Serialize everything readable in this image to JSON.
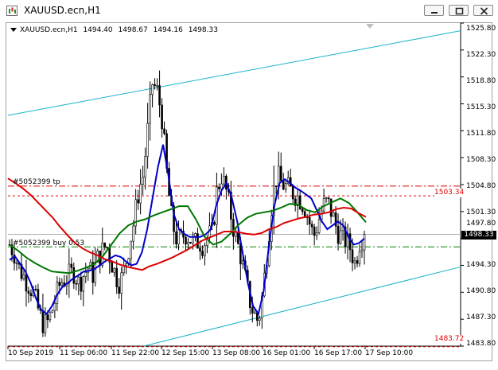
{
  "window": {
    "title": "XAUUSD.ecn,H1",
    "minimize_icon": "minimize-icon",
    "restore_icon": "restore-icon",
    "close_icon": "close-icon"
  },
  "chart_header": {
    "symbol": "XAUUSD.ecn,H1",
    "open": "1494.40",
    "high": "1498.67",
    "low": "1494.16",
    "close": "1498.33"
  },
  "price_axis": {
    "labels": [
      "1525.80",
      "1522.30",
      "1518.80",
      "1515.30",
      "1511.80",
      "1508.30",
      "1504.80",
      "1501.30",
      "1497.80",
      "1494.30",
      "1490.80",
      "1487.30",
      "1483.80"
    ],
    "current_price": "1498.33",
    "level_high": "1503.34",
    "level_low": "1483.72"
  },
  "time_axis": {
    "labels": [
      "10 Sep 2019",
      "11 Sep 06:00",
      "11 Sep 22:00",
      "12 Sep 15:00",
      "13 Sep 08:00",
      "16 Sep 01:00",
      "16 Sep 17:00",
      "17 Sep 10:00"
    ]
  },
  "orders": {
    "tp_label": "#5052399 tp",
    "buy_label": "#5052399 buy 0.53"
  },
  "colors": {
    "candle": "#000000",
    "fast_ma": "#0000cc",
    "mid_ma": "#007700",
    "slow_ma": "#dd0000",
    "channel": "#1ab3c8",
    "tp_line": "#e00000",
    "buy_line": "#008000",
    "grid": "#c8c8c8"
  },
  "chart_data": {
    "type": "candlestick",
    "symbol": "XAUUSD.ecn",
    "timeframe": "H1",
    "ylim": [
      1483.8,
      1525.8
    ],
    "y_ticks": [
      1525.8,
      1522.3,
      1518.8,
      1515.3,
      1511.8,
      1508.3,
      1504.8,
      1501.3,
      1497.8,
      1494.3,
      1490.8,
      1487.3,
      1483.8
    ],
    "x_ticks": [
      "10 Sep 2019",
      "11 Sep 06:00",
      "11 Sep 22:00",
      "12 Sep 15:00",
      "13 Sep 08:00",
      "16 Sep 01:00",
      "16 Sep 17:00",
      "17 Sep 10:00"
    ],
    "current_price": 1498.33,
    "levels": [
      {
        "label": "tp",
        "price": 1504.6
      },
      {
        "label": "",
        "price": 1503.34
      },
      {
        "label": "buy",
        "price": 1496.7
      },
      {
        "label": "",
        "price": 1483.72
      }
    ],
    "close_path": [
      1497,
      1496,
      1494,
      1493,
      1492,
      1491,
      1489,
      1487,
      1486.5,
      1488,
      1490,
      1492,
      1492.5,
      1493,
      1493.5,
      1492,
      1493,
      1494,
      1493,
      1495,
      1496,
      1497,
      1495,
      1493,
      1492,
      1494,
      1497,
      1500,
      1504,
      1506,
      1512,
      1518,
      1517,
      1514,
      1507,
      1501,
      1498,
      1497.5,
      1498.5,
      1498,
      1497,
      1497.5,
      1497,
      1498,
      1498.5,
      1504,
      1506,
      1504,
      1501,
      1498,
      1496,
      1493,
      1490,
      1488,
      1487,
      1491,
      1497,
      1503,
      1506,
      1505,
      1504.5,
      1504,
      1503.5,
      1503,
      1502,
      1500,
      1498,
      1500,
      1502,
      1502.5,
      1501,
      1499,
      1498,
      1497.5,
      1496.5,
      1494.5,
      1497.5,
      1498.33
    ],
    "series": [
      {
        "name": "",
        "values": [
          1495,
          1495.5,
          1494.5,
          1493.5,
          1492,
          1490,
          1488.5,
          1488,
          1489,
          1490.5,
          1491.5,
          1492,
          1492.6,
          1493,
          1493.5,
          1493.6,
          1493.8,
          1494.3,
          1494.8,
          1495.2,
          1495.6,
          1495.4,
          1494.8,
          1494.3,
          1494.5,
          1496,
          1499,
          1503,
          1507,
          1510,
          1506,
          1501,
          1499,
          1498.4,
          1498,
          1498,
          1498,
          1498.3,
          1499,
          1502,
          1504,
          1505,
          1503,
          1500,
          1496,
          1492,
          1489,
          1488,
          1491,
          1497,
          1502,
          1505,
          1505.5,
          1505,
          1504.4,
          1504,
          1503.5,
          1503,
          1501.5,
          1500,
          1499,
          1499.5,
          1500,
          1499.5,
          1498,
          1497,
          1497.2,
          1497.8
        ]
      },
      {
        "name": "",
        "values": [
          1497,
          1496.2,
          1495.3,
          1494.6,
          1494,
          1493.5,
          1493.4,
          1493.3,
          1493.6,
          1494,
          1494.5,
          1495.5,
          1497,
          1498.5,
          1499.5,
          1500,
          1500.3,
          1500.8,
          1501.2,
          1501.6,
          1502,
          1502,
          1500.2,
          1498,
          1497,
          1497.4,
          1498.4,
          1499.6,
          1500.5,
          1501,
          1501.2,
          1501.4,
          1501.8,
          1502.3,
          1502.2,
          1501.5,
          1501.2,
          1502,
          1502.5,
          1503,
          1502.4,
          1501.2,
          1499.9
        ]
      },
      {
        "name": "",
        "values": [
          1505.6,
          1505,
          1504.3,
          1503.5,
          1502.5,
          1501.5,
          1500.5,
          1499.3,
          1498.2,
          1497.2,
          1496.5,
          1496,
          1495.6,
          1495.1,
          1494.8,
          1494.4,
          1494.1,
          1493.9,
          1493.7,
          1494.2,
          1494.5,
          1494.9,
          1495.3,
          1495.8,
          1496.3,
          1496.9,
          1497.5,
          1497.9,
          1498.3,
          1498.7,
          1498.7,
          1498.6,
          1498.4,
          1498.3,
          1498.5,
          1499,
          1499.3,
          1499.8,
          1500.1,
          1500.4,
          1500.6,
          1500.9,
          1501,
          1501.2,
          1501.6,
          1501.8,
          1501.7,
          1501.1,
          1500.6
        ]
      }
    ],
    "trendlines": [
      {
        "name": "upper-channel",
        "from": [
          0,
          1513.8
        ],
        "to": [
          1,
          1524.8
        ]
      },
      {
        "name": "lower-channel",
        "from": [
          0.3,
          1483.8
        ],
        "to": [
          1,
          1494.1
        ]
      }
    ]
  }
}
